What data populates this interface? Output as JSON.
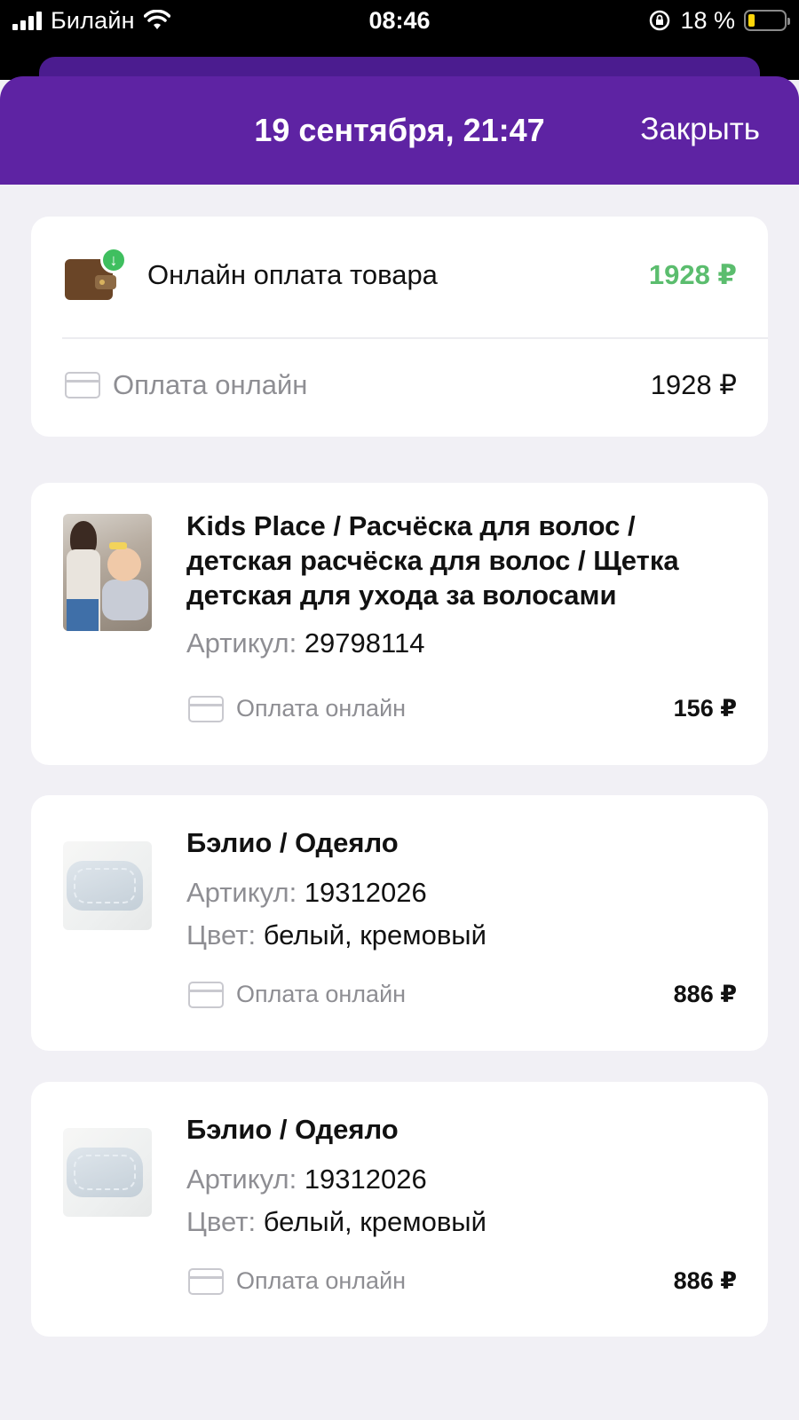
{
  "status_bar": {
    "carrier": "Билайн",
    "time": "08:46",
    "battery_percent": "18 %",
    "battery_level": 0.18,
    "icons": [
      "signal-icon",
      "wifi-icon",
      "orientation-lock-icon",
      "battery-icon"
    ]
  },
  "header": {
    "title": "19 сентября, 21:47",
    "close_label": "Закрыть"
  },
  "summary": {
    "title": "Онлайн оплата товара",
    "amount": "1928 ₽",
    "payment_label": "Оплата онлайн",
    "payment_amount": "1928 ₽",
    "icon": "wallet-icon",
    "amount_color": "#5bbd6e"
  },
  "products": [
    {
      "title": "Kids Place / Расчёска для волос / детская расчёска для волос / Щетка детская для ухода за волосами",
      "article_label": "Артикул:",
      "article": "29798114",
      "payment_label": "Оплата онлайн",
      "price": "156 ₽"
    },
    {
      "title": "Бэлио / Одеяло",
      "article_label": "Артикул:",
      "article": "19312026",
      "color_label": "Цвет:",
      "color": "белый, кремовый",
      "payment_label": "Оплата онлайн",
      "price": "886 ₽"
    },
    {
      "title": "Бэлио / Одеяло",
      "article_label": "Артикул:",
      "article": "19312026",
      "color_label": "Цвет:",
      "color": "белый, кремовый",
      "payment_label": "Оплата онлайн",
      "price": "886 ₽"
    }
  ],
  "colors": {
    "header": "#5e23a3",
    "background": "#f1f0f5"
  }
}
